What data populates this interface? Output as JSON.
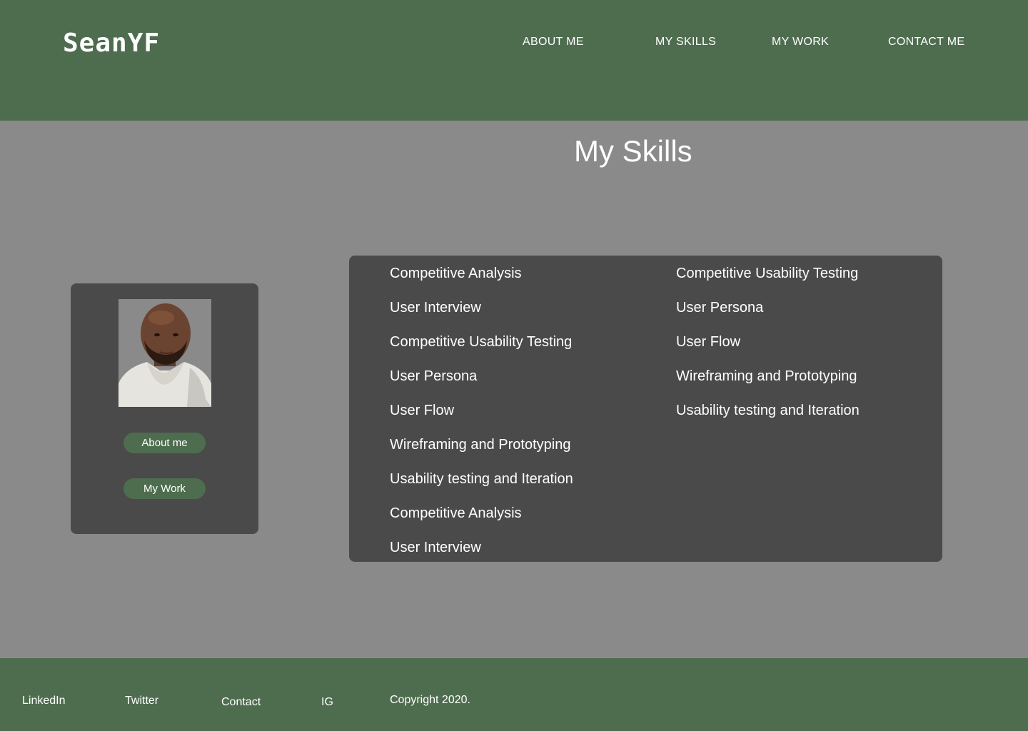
{
  "header": {
    "logo": "SeanYF",
    "nav": [
      {
        "label": "ABOUT ME"
      },
      {
        "label": "MY SKILLS"
      },
      {
        "label": "MY WORK"
      },
      {
        "label": "CONTACT ME"
      }
    ]
  },
  "main": {
    "title": "My Skills",
    "profile": {
      "buttons": [
        {
          "label": "About me"
        },
        {
          "label": "My Work"
        }
      ]
    },
    "skills_left": [
      "Competitive Analysis",
      "User Interview",
      "Competitive Usability Testing",
      "User Persona",
      "User Flow",
      "Wireframing and Prototyping",
      "Usability testing and Iteration",
      "Competitive Analysis",
      "User Interview"
    ],
    "skills_right": [
      "Competitive Usability Testing",
      "User Persona",
      "User Flow",
      "Wireframing and Prototyping",
      "Usability testing and Iteration"
    ]
  },
  "footer": {
    "links": [
      {
        "label": "LinkedIn"
      },
      {
        "label": "Twitter"
      },
      {
        "label": "Contact"
      },
      {
        "label": "IG"
      }
    ],
    "copyright": "Copyright 2020."
  },
  "colors": {
    "header_bg": "#4e6d4f",
    "page_bg": "#8a8a8a",
    "panel_bg": "#4a4a4a",
    "accent": "#4e6d4f"
  }
}
